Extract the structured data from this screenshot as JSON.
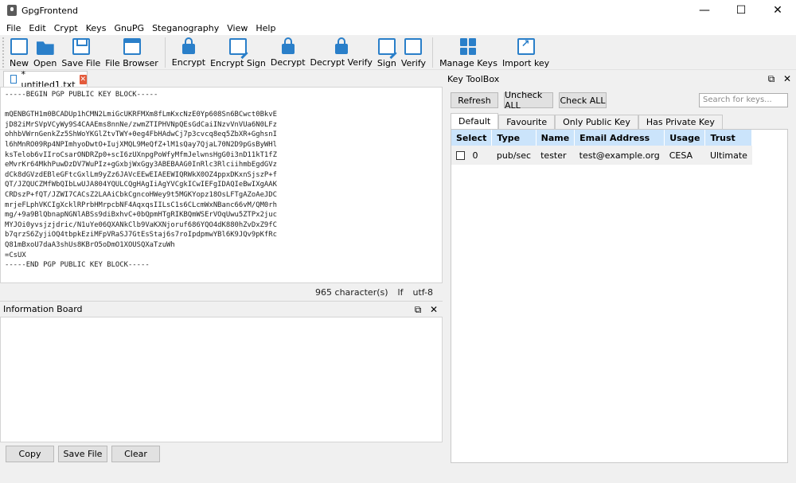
{
  "window": {
    "title": "GpgFrontend"
  },
  "menu": [
    "File",
    "Edit",
    "Crypt",
    "Keys",
    "GnuPG",
    "Steganography",
    "View",
    "Help"
  ],
  "toolbar": {
    "new": "New",
    "open": "Open",
    "save_file": "Save File",
    "file_browser": "File Browser",
    "encrypt": "Encrypt",
    "encrypt_sign": "Encrypt Sign",
    "decrypt": "Decrypt",
    "decrypt_verify": "Decrypt Verify",
    "sign": "Sign",
    "verify": "Verify",
    "manage_keys": "Manage Keys",
    "import_key": "Import key"
  },
  "editor": {
    "tab_label": "* untitled1.txt",
    "content": "-----BEGIN PGP PUBLIC KEY BLOCK-----\n\nmQENBGTH1m0BCADUp1hCMN2LmiGcUKRFMXm8fLmKxcNzE0Yp608Sn6BCwct0BkvE\njD82iMrSVpVCyWy9S4CAAEms8nnNe/zwmZTIPHVNpQEsGdCaiINzvVnVUa6N0LFz\nohhbVWrnGenkZz5ShWoYKGlZtvTWY+0eg4FbHAdwCj7p3cvcq8eq5ZbXR+GghsnI\nl6hMnRO09Rp4NPImhyoDwtO+IujXMQL9MeQfZ+lM1sQay7QjaL70N2D9pGsByWHl\nksTelob6vIIroCsarONDRZp0+scI6zUXnpgPoWfyMfmJelwnsHgG0i3nD11kT1fZ\neMvrKr64MkhPuwDzDV7WuPIz+gGxbjWxGgy3ABEBAAG0InRlc3RlciihmbEgdGVz\ndCk8dGVzdEBleGFtcGxlLm9yZz6JAVcEEwEIAEEWIQRWkX0OZ4ppxDKxnSjszP+f\nQT/JZQUCZMfWbQIbLwUJA804YQULCQgHAgIiAgYVCgkICwIEFgIDAQIeBwIXgAAK\nCRDszP+fQT/JZWI7CACsZ2LAAiCbkCgncoHWey9t5MGKYopz18OsLFTgAZoAeJDC\nmrjeFLphVKCIgXcklRPrbHMrpcbNF4AqxqsIILsC1s6CLcmWxNBanc66vM/QM0rh\nmg/+9a9BlQbnapNGNlABSs9diBxhvC+0bQpmHTgRIKBQmWSErVOqUwu5ZTPx2juc\nMYJOi0yvsjzjdric/N1uYe06QXANkClb9VaKXNjoruf686YQO4dK880hZvDxZ9fC\nb7qrzS6ZyjiOQ4tbpkEziMFpVRaSJ7GtEsStaj6s7roIpdpmwYBl6K9JQv9pKfRc\nQ81mBxoU7daA3shUs8KBrO5oDmO1XOUSQXaTzuWh\n=CsUX\n-----END PGP PUBLIC KEY BLOCK-----"
  },
  "status": {
    "chars": "965 character(s)",
    "line_ending": "lf",
    "encoding": "utf-8"
  },
  "info_board": {
    "title": "Information Board",
    "copy": "Copy",
    "save_file": "Save File",
    "clear": "Clear"
  },
  "key_toolbox": {
    "title": "Key ToolBox",
    "refresh": "Refresh",
    "uncheck_all": "Uncheck ALL",
    "check_all": "Check ALL",
    "search_placeholder": "Search for keys...",
    "tabs": [
      "Default",
      "Favourite",
      "Only Public Key",
      "Has Private Key"
    ],
    "columns": [
      "Select",
      "Type",
      "Name",
      "Email Address",
      "Usage",
      "Trust"
    ],
    "rows": [
      {
        "select": "0",
        "type": "pub/sec",
        "name": "tester",
        "email": "test@example.org",
        "usage": "CESA",
        "trust": "Ultimate"
      }
    ]
  }
}
